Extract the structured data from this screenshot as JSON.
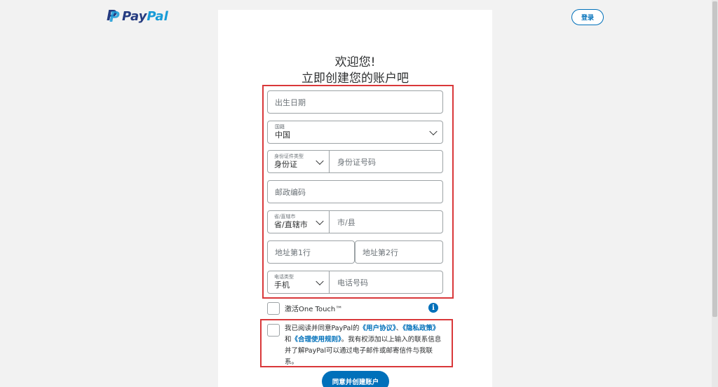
{
  "header": {
    "logo_text_pay": "Pay",
    "logo_text_pal": "Pal",
    "login_label": "登录"
  },
  "heading": {
    "line1": "欢迎您!",
    "line2": "立即创建您的账户吧"
  },
  "form": {
    "birthdate_placeholder": "出生日期",
    "nationality": {
      "label": "国籍",
      "value": "中国"
    },
    "id_type": {
      "label": "身份证件类型",
      "value": "身份证"
    },
    "id_number_placeholder": "身份证号码",
    "postcode_placeholder": "邮政编码",
    "province": {
      "label": "省/直辖市",
      "value": "省/直辖市"
    },
    "city_placeholder": "市/县",
    "address1_placeholder": "地址第1行",
    "address2_placeholder": "地址第2行",
    "phone_type": {
      "label": "电话类型",
      "value": "手机"
    },
    "phone_placeholder": "电话号码"
  },
  "one_touch": {
    "label": "激活One Touch™",
    "info_glyph": "i"
  },
  "agreement": {
    "text1": "我已阅读并同意PayPal的",
    "link_user_agreement": "《用户协议》",
    "sep1": "、",
    "link_privacy": "《隐私政策》",
    "text2": "和",
    "link_acceptable_use": "《合理使用规则》",
    "text3": "。我有权添加以上输入的联系信息并了解PayPal可以通过电子邮件或邮寄信件与我联系。"
  },
  "submit_label": "同意并创建账户",
  "colors": {
    "brand_blue": "#0070ba",
    "paypal_dark": "#253b80",
    "paypal_light": "#179bd7",
    "highlight_red": "#d9383a"
  },
  "icons": {
    "select_arrow": "chevron-down-icon",
    "info": "info-icon"
  }
}
